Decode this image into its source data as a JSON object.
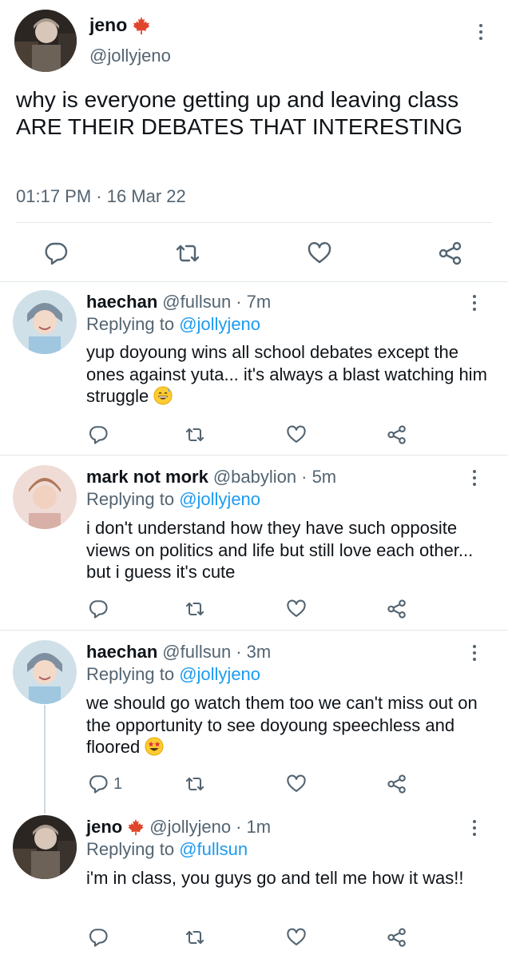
{
  "main_tweet": {
    "name": "jeno",
    "handle": "@jollyjeno",
    "text": "why is everyone getting up and leaving class ARE THEIR DEBATES THAT INTERESTING",
    "timestamp": "01:17 PM · 16 Mar 22",
    "name_emoji": "maple-leaf-icon"
  },
  "replies": [
    {
      "name": "haechan",
      "handle": "@fullsun",
      "time": "· 7m",
      "replying_label": "Replying to",
      "replying_to": "@jollyjeno",
      "text": "yup doyoung wins all school debates except the ones against yuta... it's always a blast watching him struggle",
      "emoji": "grinning-sweat-face-icon",
      "reply_count": ""
    },
    {
      "name": "mark not mork",
      "handle": "@babylion",
      "time": "· 5m",
      "replying_label": "Replying to",
      "replying_to": "@jollyjeno",
      "text": "i don't understand how they have such opposite views on politics and life but still love each other... but i guess it's cute",
      "emoji": "",
      "reply_count": ""
    },
    {
      "name": "haechan",
      "handle": "@fullsun",
      "time": "· 3m",
      "replying_label": "Replying to",
      "replying_to": "@jollyjeno",
      "text": "we should go watch them too we can't miss out on the opportunity to see doyoung speechless and floored",
      "emoji": "star-struck-face-icon",
      "reply_count": "1"
    },
    {
      "name": "jeno",
      "handle": "@jollyjeno",
      "time": "· 1m",
      "replying_label": "Replying to",
      "replying_to": "@fullsun",
      "text": "i'm in class, you guys go and tell me how it was!!",
      "emoji": "",
      "reply_count": ""
    }
  ],
  "colors": {
    "text": "#0f1419",
    "muted": "#536471",
    "link": "#1d9bf0",
    "divider": "#e1e8ed",
    "maple": "#e0452b"
  }
}
